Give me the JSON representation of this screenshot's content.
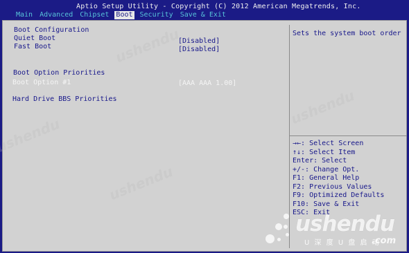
{
  "header": {
    "title": "Aptio Setup Utility - Copyright (C) 2012 American Megatrends, Inc.",
    "tabs": [
      {
        "label": "Main"
      },
      {
        "label": "Advanced"
      },
      {
        "label": "Chipset"
      },
      {
        "label": "Boot"
      },
      {
        "label": "Security"
      },
      {
        "label": "Save & Exit"
      }
    ]
  },
  "boot": {
    "boot_configuration": "Boot Configuration",
    "quiet_boot_label": "Quiet Boot",
    "quiet_boot_value": "[Disabled]",
    "fast_boot_label": "Fast Boot",
    "fast_boot_value": "[Disabled]",
    "boot_option_priorities": "Boot Option Priorities",
    "boot_option_1_label": "Boot Option #1",
    "boot_option_1_value": "[AAA AAA 1.00]",
    "hdd_bbs_priorities": "Hard Drive BBS Priorities"
  },
  "help": {
    "description": "Sets the system boot order",
    "lines": [
      "→←: Select Screen",
      "↑↓: Select Item",
      "Enter: Select",
      "+/-: Change Opt.",
      "F1: General Help",
      "F2: Previous Values",
      "F9: Optimized Defaults",
      "F10: Save & Exit",
      "ESC: Exit"
    ]
  },
  "watermark": {
    "text": "ushendu",
    "logo": "ushendu",
    "logo_sub": "U 深 度 U 盘 启 动",
    "logo_com": ".com"
  }
}
